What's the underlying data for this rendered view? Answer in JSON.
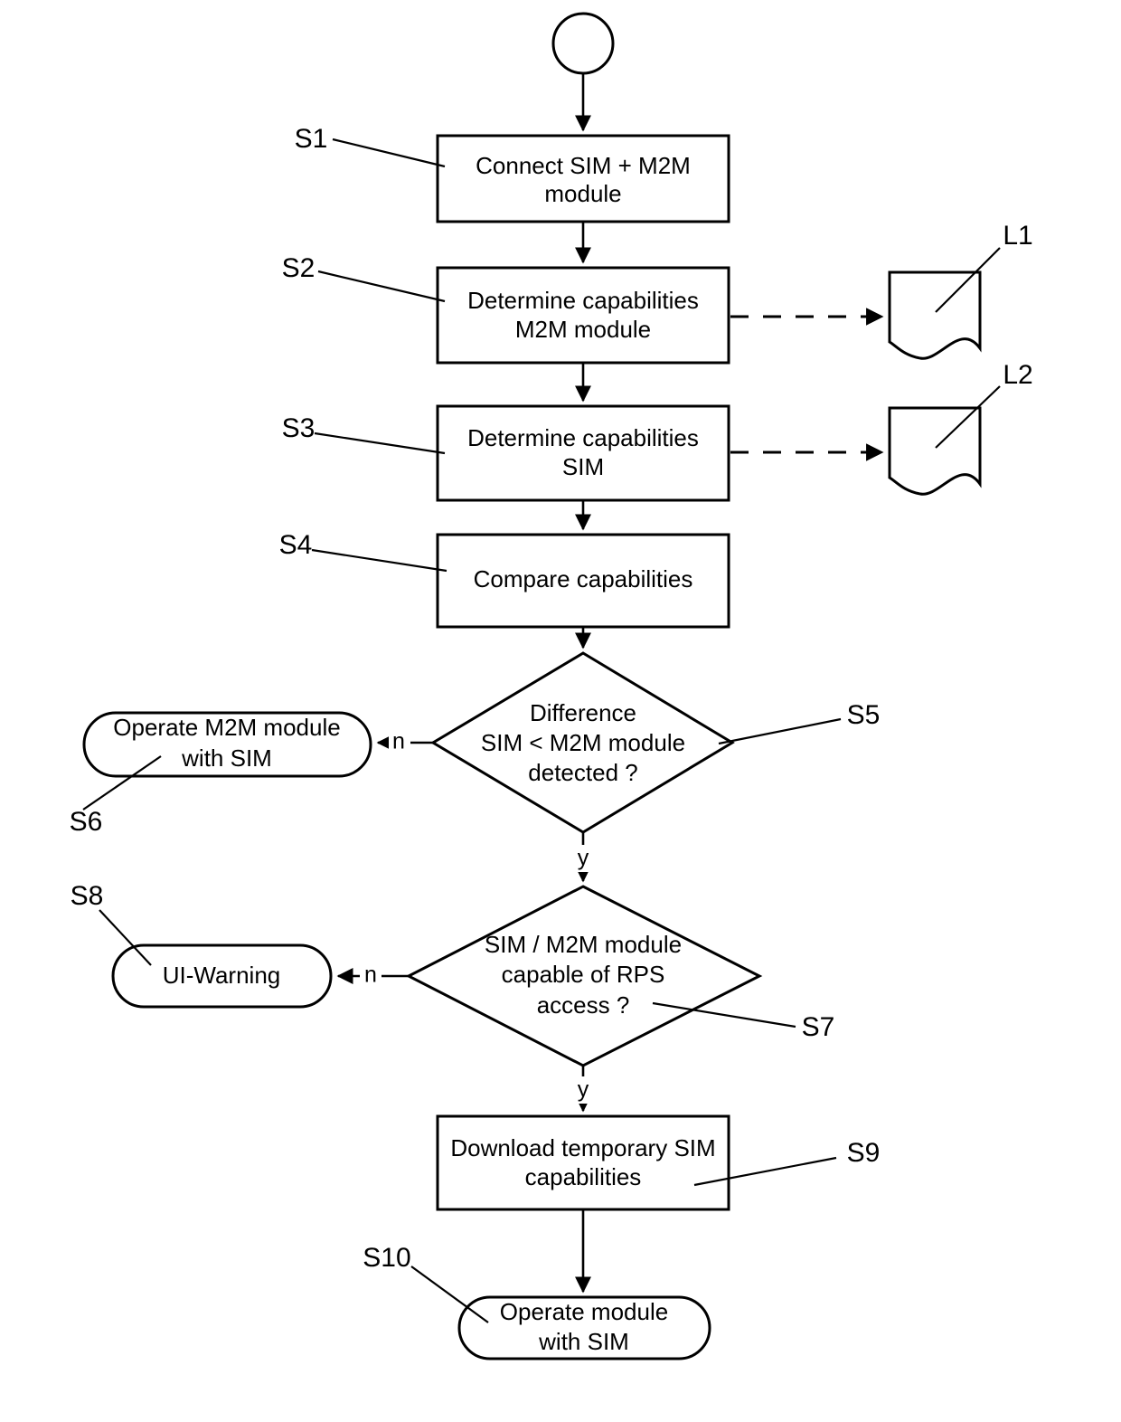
{
  "diagram": {
    "type": "flowchart",
    "title": "",
    "start": {
      "ref": "",
      "label": ""
    },
    "nodes": [
      {
        "id": "S1",
        "ref_label": "S1",
        "shape": "process",
        "lines": [
          "Connect SIM + M2M",
          "module"
        ]
      },
      {
        "id": "S2",
        "ref_label": "S2",
        "shape": "process",
        "lines": [
          "Determine capabilities",
          "M2M module"
        ]
      },
      {
        "id": "S3",
        "ref_label": "S3",
        "shape": "process",
        "lines": [
          "Determine capabilities",
          "SIM"
        ]
      },
      {
        "id": "S4",
        "ref_label": "S4",
        "shape": "process",
        "lines": [
          "Compare capabilities"
        ]
      },
      {
        "id": "S5",
        "ref_label": "S5",
        "shape": "decision",
        "lines": [
          "Difference",
          "SIM < M2M module",
          "detected ?"
        ]
      },
      {
        "id": "S6",
        "ref_label": "S6",
        "shape": "terminator",
        "lines": [
          "Operate M2M module",
          "with SIM"
        ]
      },
      {
        "id": "S7",
        "ref_label": "S7",
        "shape": "decision",
        "lines": [
          "SIM / M2M module",
          "capable of RPS",
          "access ?"
        ]
      },
      {
        "id": "S8",
        "ref_label": "S8",
        "shape": "terminator",
        "lines": [
          "UI-Warning"
        ]
      },
      {
        "id": "S9",
        "ref_label": "S9",
        "shape": "process",
        "lines": [
          "Download temporary SIM",
          "capabilities"
        ]
      },
      {
        "id": "S10",
        "ref_label": "S10",
        "shape": "terminator",
        "lines": [
          "Operate module",
          "with SIM"
        ]
      },
      {
        "id": "L1",
        "ref_label": "L1",
        "shape": "document",
        "lines": []
      },
      {
        "id": "L2",
        "ref_label": "L2",
        "shape": "document",
        "lines": []
      }
    ],
    "edge_labels": {
      "s5_no": "n",
      "s5_yes": "y",
      "s7_no": "n",
      "s7_yes": "y"
    },
    "colors": {
      "stroke": "#000000",
      "fill": "#ffffff",
      "background": "#ffffff"
    }
  }
}
